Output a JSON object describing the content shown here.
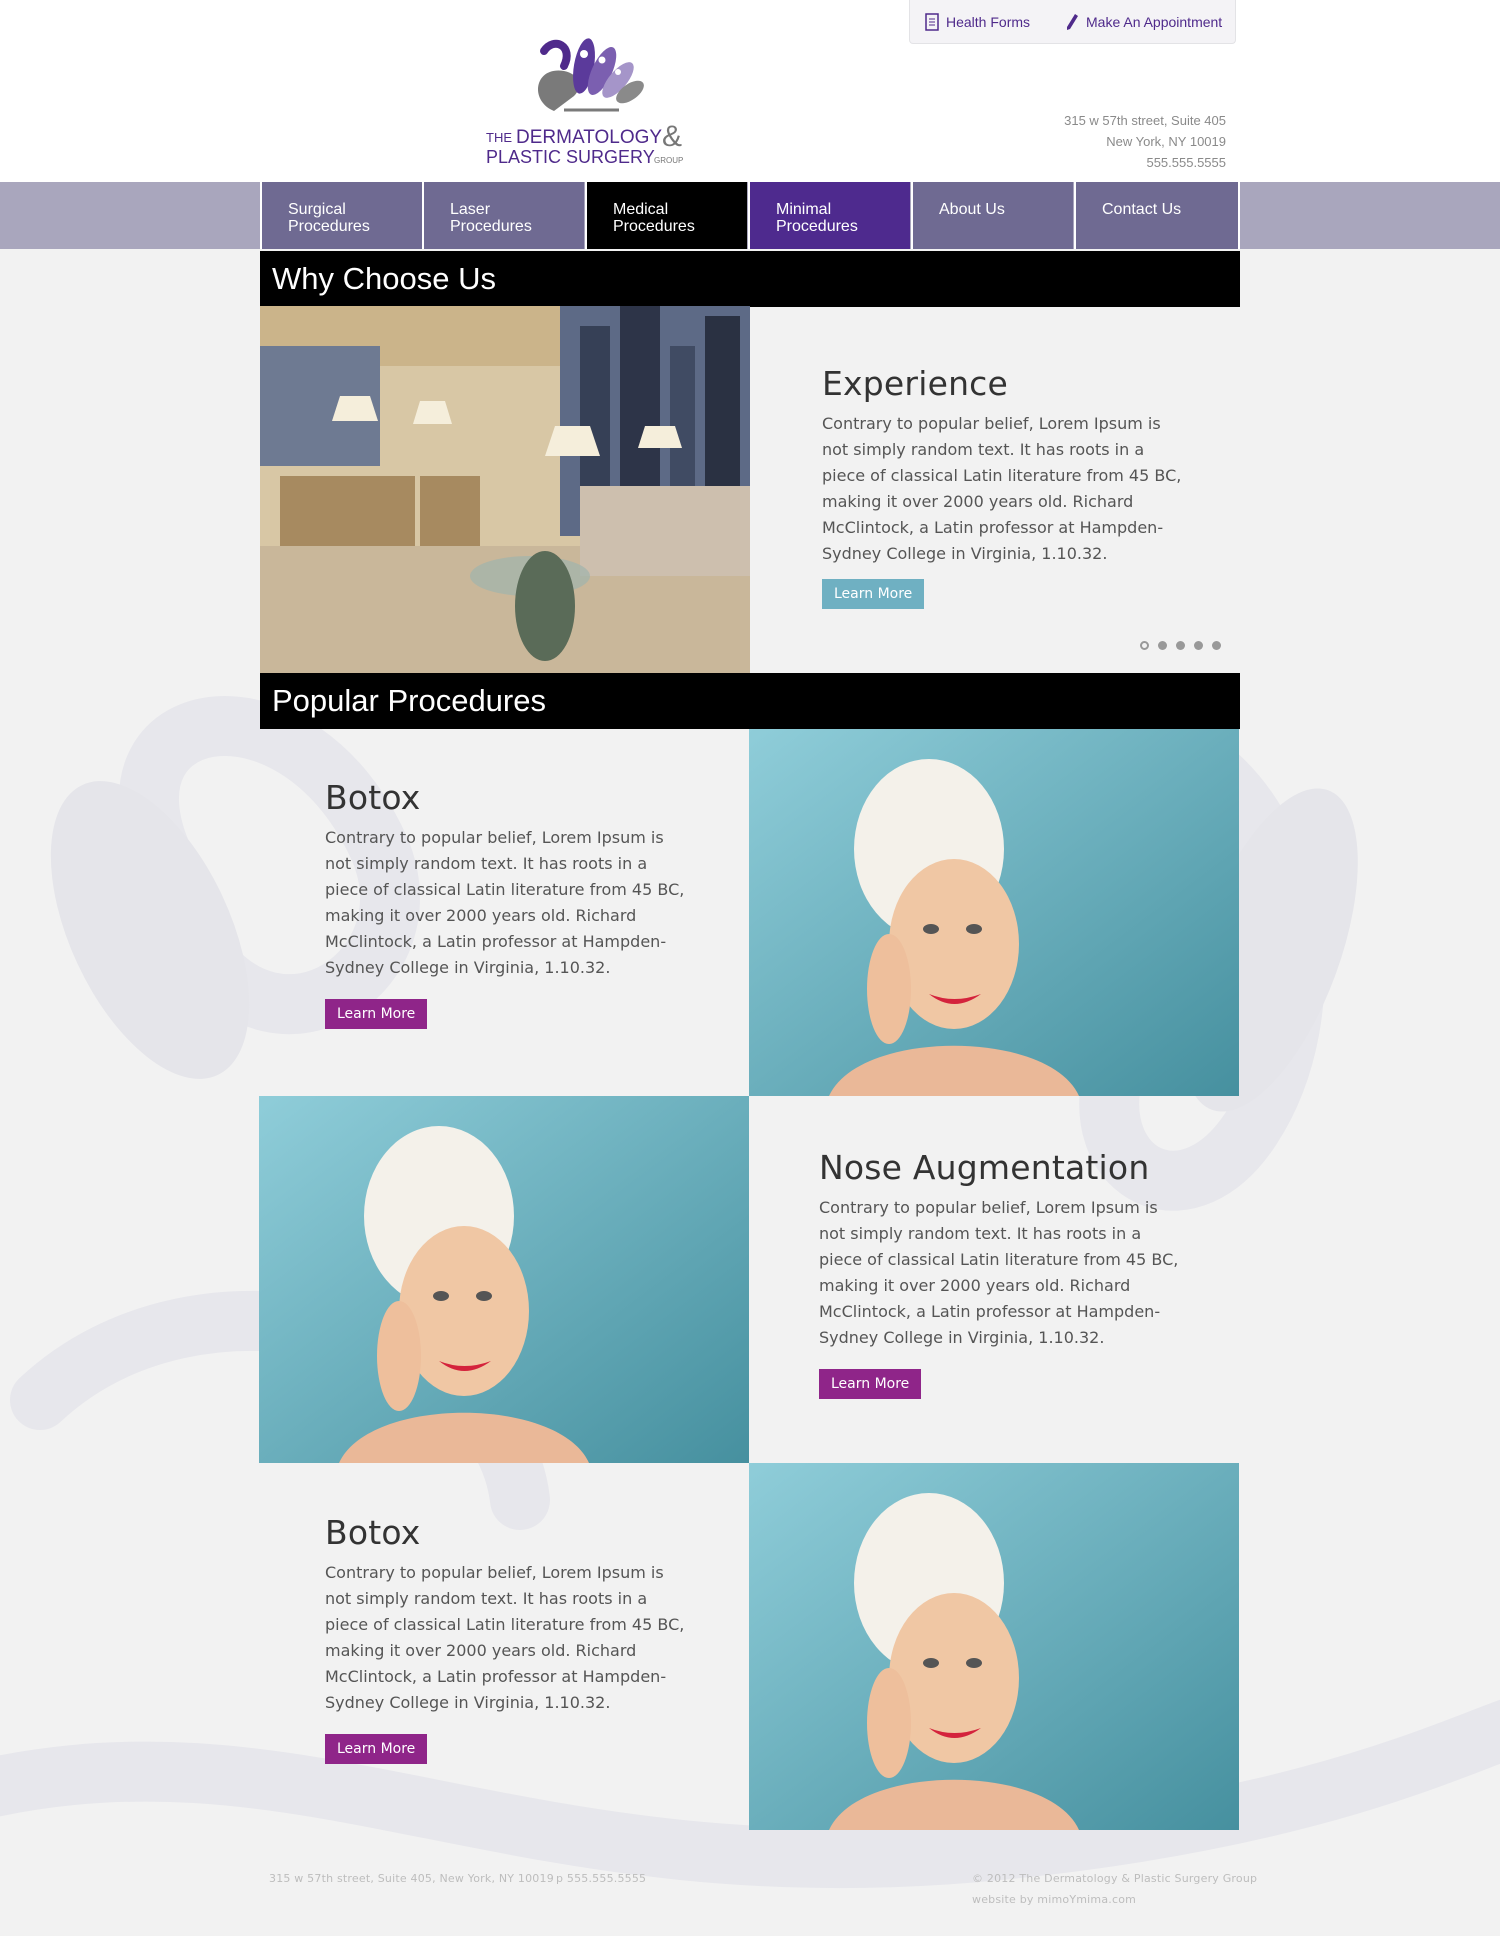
{
  "topbar": {
    "health_forms": "Health Forms",
    "appointment": "Make An Appointment"
  },
  "logo": {
    "the": "THE",
    "dermatology": "DERMATOLOGY",
    "amp": "&",
    "plastic_surgery": "PLASTIC SURGERY",
    "group": "GROUP"
  },
  "address": {
    "line1": "315 w 57th street, Suite 405",
    "line2": "New York, NY 10019",
    "phone": "555.555.5555"
  },
  "nav": {
    "items": [
      {
        "label": "Surgical Procedures"
      },
      {
        "label": "Laser Procedures"
      },
      {
        "label": "Medical Procedures"
      },
      {
        "label": "Minimal Procedures"
      },
      {
        "label": "About Us"
      },
      {
        "label": "Contact Us"
      }
    ]
  },
  "why": {
    "heading": "Why Choose Us",
    "title": "Experience",
    "body": "Contrary to popular belief, Lorem Ipsum is not simply random text. It has roots in a piece of classical Latin literature from 45 BC, making it over 2000 years old. Richard McClintock, a Latin professor at Hampden-Sydney College in Virginia, 1.10.32.",
    "button": "Learn More",
    "slide_count": 5,
    "active_slide": 1
  },
  "popular": {
    "heading": "Popular Procedures",
    "items": [
      {
        "title": "Botox",
        "body": "Contrary to popular belief, Lorem Ipsum is not simply random text. It has roots in a piece of classical Latin literature from 45 BC, making it over 2000 years old. Richard McClintock, a Latin professor at Hampden-Sydney College in Virginia, 1.10.32.",
        "button": "Learn More"
      },
      {
        "title": "Nose Augmentation",
        "body": "Contrary to popular belief, Lorem Ipsum is not simply random text. It has roots in a piece of classical Latin literature from 45 BC, making it over 2000 years old. Richard McClintock, a Latin professor at Hampden-Sydney College in Virginia, 1.10.32.",
        "button": "Learn More"
      },
      {
        "title": "Botox",
        "body": "Contrary to popular belief, Lorem Ipsum is not simply random text. It has roots in a piece of classical Latin literature from 45 BC, making it over 2000 years old. Richard McClintock, a Latin professor at Hampden-Sydney College in Virginia, 1.10.32.",
        "button": "Learn More"
      }
    ]
  },
  "footer": {
    "address": "315 w 57th street, Suite 405, New York, NY 10019",
    "phone": "p 555.555.5555",
    "copyright": "© 2012 The Dermatology & Plastic Surgery Group",
    "credit": "website by mimoYmima.com"
  },
  "colors": {
    "brand_purple": "#4f2a8b",
    "nav_bg": "#6f6a92",
    "nav_active": "#000000",
    "nav_highlight": "#4e2a8e",
    "button_teal": "#6fb0c2",
    "button_purple": "#8f2589",
    "photo_teal": "#5fa7b6"
  },
  "icons": {
    "health_forms": "document-icon",
    "appointment": "pencil-icon"
  }
}
